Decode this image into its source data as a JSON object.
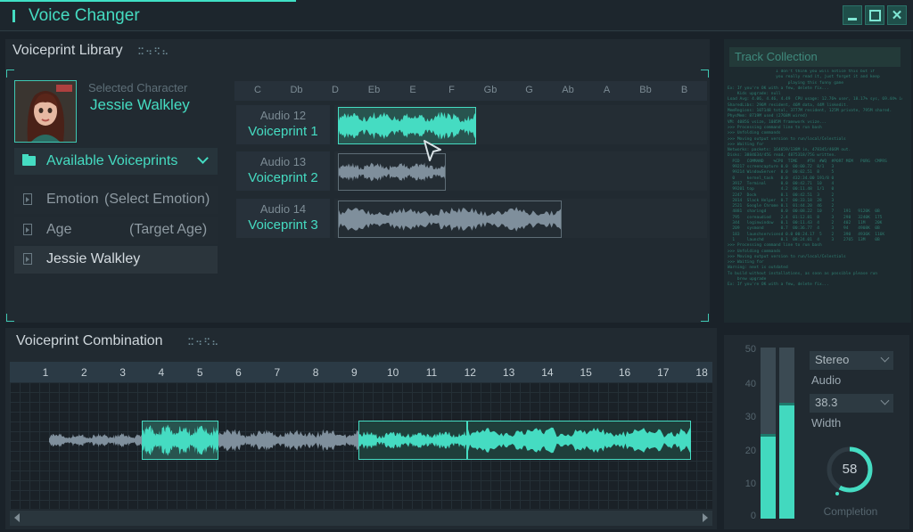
{
  "window": {
    "title": "Voice Changer",
    "buttons": [
      "minimize",
      "maximize",
      "close"
    ]
  },
  "library": {
    "title": "Voiceprint Library",
    "title_dots": "⠭⠲⠫⠦",
    "selected_label": "Selected Character",
    "selected_name": "Jessie Walkley",
    "available_label": "Available Voiceprints",
    "items": [
      {
        "label": "Emotion",
        "value": "(Select Emotion)"
      },
      {
        "label": "Age",
        "value": "(Target Age)"
      },
      {
        "label": "Jessie Walkley",
        "value": ""
      }
    ],
    "keys": [
      "C",
      "Db",
      "D",
      "Eb",
      "E",
      "F",
      "Gb",
      "G",
      "Ab",
      "A",
      "Bb",
      "B"
    ],
    "tracks": [
      {
        "audio": "Audio 12",
        "voiceprint": "Voiceprint 1"
      },
      {
        "audio": "Audio 13",
        "voiceprint": "Voiceprint 2"
      },
      {
        "audio": "Audio 14",
        "voiceprint": "Voiceprint 3"
      }
    ]
  },
  "console": {
    "header": "Track Collection",
    "lines": [
      "                    I don't think you will notice this but if",
      "                    you really read it, just forget it and keep",
      "                         playing this funny game",
      "",
      "Ex: If you're OK with a few, delete fix...",
      "    Kids upgrade: null",
      "Load Avg: 4.06, 4.46, 4.49  CPU usage: 12.76% user, 18.17% sys, 69.44% idle",
      "SharedLibs: 296M resident, 46M data, 44M linkedit.",
      "MemRegions: 107148 total, 3777M resident, 125M private, 795M shared.",
      "PhysMem: 8719M used (2768M wired)",
      "VM: 4085G vsize, 1085M framework vsize...",
      ">>> Processing command line to run bash",
      ">>> Unfolding commands",
      ">>> Moving output version to run/local/Celestials",
      ">>> Waiting for",
      "Networks: packets: 164659/138M in, 478345/466M out.",
      "Disks: 3884634/45G read, 4875318/75G written.",
      "  PID   COMMAND    %CPU  TIME    #TH  #WQ  #PORT MEM   PURG  CMPRS",
      "  99217 screencapture 0.0  00:00.72  8/1   3",
      "  99214 WindowServer  0.0  00:02.51  8     5",
      "  0     kernel_task   0.0  432:34.00 191/8 0",
      "  3917  Terminal      0.0  00:42.71  10    4",
      "  99201 top           4.2  00:11.48  1/1   0",
      "  2247  Dock          0.1  00:42.51  3     2",
      "  2814  Slack Helper  0.7  00:33.18  28    3",
      "  2521  Google Chrome 0.1  01:44.20  46    2",
      "  4881  sharingd      0.0  00:08.22  10    7    191   9120K  0B",
      "  795   coreaudiod    2.4  01:12.81  8     3    298   3240K  175",
      "  344   loginwindow   0.1  00:11.43  4     2    402   11M    20K",
      "  209   sysmond       0.7  00:36.77  4     3    94    4908K  0B",
      "  183   launchservicesd 0.0 00:24.17  5    2    390   4936K  116K",
      "  1     launchd       0.1  08:24.01  4     3    2765  13M    0B",
      ">>> Processing command line to run bash",
      ">>> Unfolding commands",
      ">>> Moving output version to run/local/Celestials",
      ">>> Waiting for",
      "Warning: next is outdated",
      "To build without installations, as soon as possible please run",
      "    brew upgrade",
      "Ex: If you're OK with a few, delete fix..."
    ]
  },
  "combination": {
    "title": "Voiceprint Combination",
    "title_dots": "⠭⠲⠫⠦",
    "ruler": [
      "1",
      "2",
      "3",
      "4",
      "5",
      "6",
      "7",
      "8",
      "9",
      "10",
      "11",
      "12",
      "13",
      "14",
      "15",
      "16",
      "17",
      "18"
    ]
  },
  "controls": {
    "scale": [
      "50",
      "40",
      "30",
      "20",
      "10",
      "0"
    ],
    "meters": [
      {
        "level": 0.48,
        "marker": 0.48
      },
      {
        "level": 0.66,
        "marker": 0.66
      }
    ],
    "mode": "Stereo",
    "audio_label": "Audio",
    "width_value": "38.3",
    "width_label": "Width",
    "completion_value": "58",
    "completion_fraction": 0.58,
    "completion_label": "Completion"
  },
  "colors": {
    "accent": "#45dcc2",
    "background": "#1a2229",
    "panel": "#212a31"
  }
}
